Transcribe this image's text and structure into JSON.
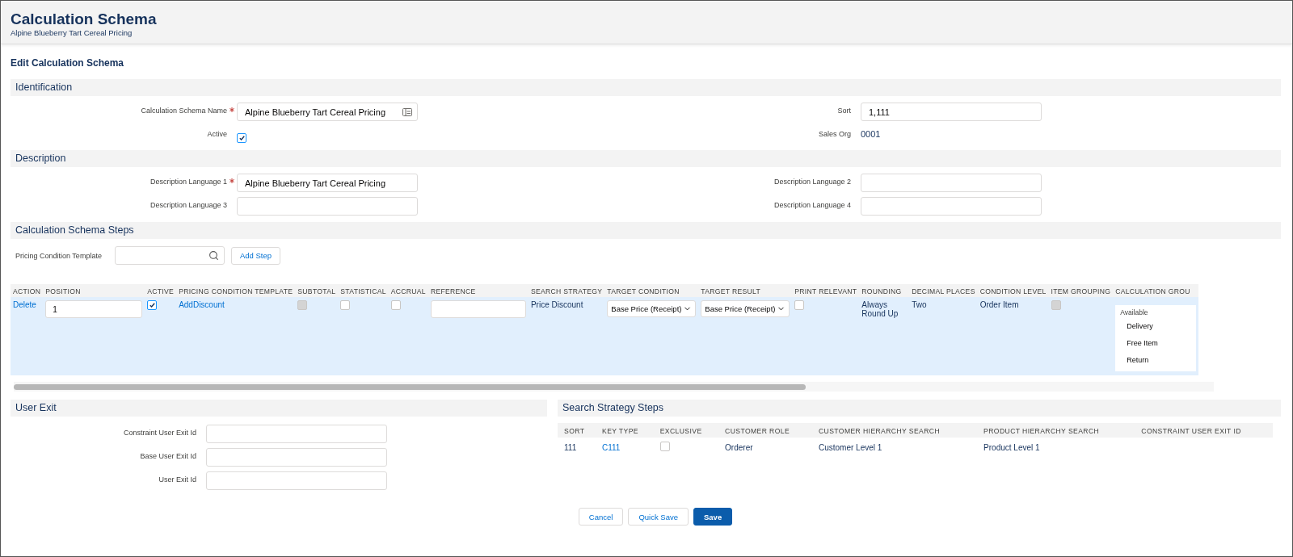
{
  "header": {
    "title": "Calculation Schema",
    "subtitle": "Alpine Blueberry Tart Cereal Pricing"
  },
  "page_title": "Edit Calculation Schema",
  "identification": {
    "title": "Identification",
    "left": [
      {
        "kind": "input",
        "label": "Calculation Schema Name",
        "required": true,
        "value": "Alpine Blueberry Tart Cereal Pricing",
        "lookup": true
      },
      {
        "kind": "checkbox",
        "label": "Active",
        "required": false,
        "checked": true
      }
    ],
    "right": [
      {
        "kind": "input",
        "label": "Sort",
        "required": false,
        "value": "1,111"
      },
      {
        "kind": "text",
        "label": "Sales Org",
        "required": false,
        "value": "0001"
      }
    ]
  },
  "description": {
    "title": "Description",
    "left": [
      {
        "kind": "input",
        "label": "Description Language 1",
        "required": true,
        "value": "Alpine Blueberry Tart Cereal Pricing"
      },
      {
        "kind": "input",
        "label": "Description Language 3",
        "required": false
      }
    ],
    "right": [
      {
        "kind": "input",
        "label": "Description Language 2",
        "required": false
      },
      {
        "kind": "input",
        "label": "Description Language 4",
        "required": false
      }
    ]
  },
  "steps": {
    "title": "Calculation Schema Steps",
    "template_label": "Pricing Condition Template",
    "add_button": "Add Step",
    "columns": [
      "ACTION",
      "POSITION",
      "ACTIVE",
      "PRICING CONDITION TEMPLATE",
      "SUBTOTAL",
      "STATISTICAL",
      "ACCRUAL",
      "REFERENCE",
      "SEARCH STRATEGY",
      "TARGET CONDITION",
      "TARGET RESULT",
      "PRINT RELEVANT",
      "ROUNDING",
      "DECIMAL PLACES",
      "CONDITION LEVEL",
      "ITEM GROUPING",
      "CALCULATION GROU"
    ],
    "rows": [
      {
        "selected": true,
        "cells": [
          {
            "kind": "link",
            "text": "Delete"
          },
          {
            "kind": "input",
            "value": "1"
          },
          {
            "kind": "checkbox",
            "checked": true,
            "disabled": false
          },
          {
            "kind": "link",
            "text": "AddDiscount"
          },
          {
            "kind": "checkbox",
            "checked": false,
            "disabled": true
          },
          {
            "kind": "checkbox",
            "checked": false,
            "disabled": false
          },
          {
            "kind": "checkbox",
            "checked": false,
            "disabled": false
          },
          {
            "kind": "input"
          },
          {
            "kind": "text",
            "text": "Price Discount"
          },
          {
            "kind": "select",
            "value": "Base Price (Receipt)"
          },
          {
            "kind": "select",
            "value": "Base Price (Receipt)"
          },
          {
            "kind": "checkbox",
            "checked": false,
            "disabled": false
          },
          {
            "kind": "text",
            "text": "Always Round Up"
          },
          {
            "kind": "text",
            "text": "Two"
          },
          {
            "kind": "text",
            "text": "Order Item"
          },
          {
            "kind": "checkbox",
            "checked": false,
            "disabled": true
          },
          {
            "kind": "listbox",
            "label": "Available",
            "options": [
              "Delivery",
              "Free Item",
              "Return"
            ]
          }
        ]
      }
    ]
  },
  "user_exit": {
    "title": "User Exit",
    "fields": [
      "Constraint User Exit Id",
      "Base User Exit Id",
      "User Exit Id"
    ]
  },
  "search_strategy": {
    "title": "Search Strategy Steps",
    "columns": [
      "SORT",
      "KEY TYPE",
      "EXCLUSIVE",
      "CUSTOMER ROLE",
      "CUSTOMER HIERARCHY SEARCH",
      "PRODUCT HIERARCHY SEARCH",
      "CONSTRAINT USER EXIT ID"
    ],
    "rows": [
      {
        "cells": [
          {
            "kind": "text",
            "text": "111"
          },
          {
            "kind": "link",
            "text": "C111"
          },
          {
            "kind": "checkbox",
            "checked": false,
            "disabled": false
          },
          {
            "kind": "text",
            "text": "Orderer"
          },
          {
            "kind": "text",
            "text": "Customer Level 1"
          },
          {
            "kind": "text",
            "text": "Product Level 1"
          }
        ]
      }
    ]
  },
  "buttons": [
    {
      "label": "Cancel",
      "kind": "secondary"
    },
    {
      "label": "Quick Save",
      "kind": "secondary"
    },
    {
      "label": "Save",
      "kind": "primary"
    }
  ]
}
